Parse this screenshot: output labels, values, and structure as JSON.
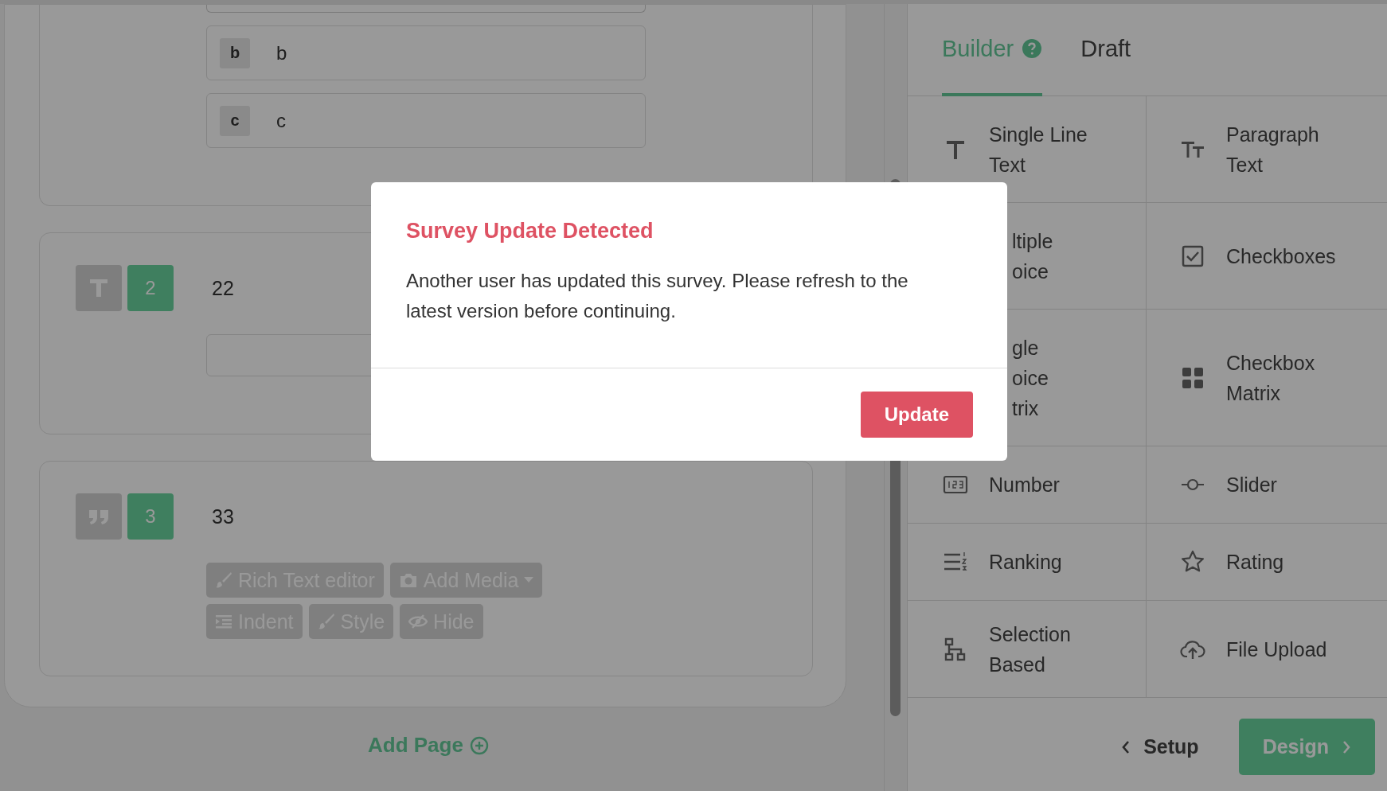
{
  "survey": {
    "options": [
      {
        "key": "b",
        "text": "b"
      },
      {
        "key": "c",
        "text": "c"
      }
    ],
    "questions": [
      {
        "kind": "text",
        "number": "2",
        "title": "22"
      },
      {
        "kind": "quote",
        "number": "3",
        "title": "33",
        "tools": [
          {
            "label": "Rich Text editor",
            "dropdown": false
          },
          {
            "label": "Add Media",
            "dropdown": true
          },
          {
            "label": "Indent",
            "dropdown": false
          },
          {
            "label": "Style",
            "dropdown": false
          },
          {
            "label": "Hide",
            "dropdown": false
          }
        ]
      }
    ],
    "add_page": "Add Page"
  },
  "panel": {
    "tabs": [
      {
        "label": "Builder",
        "selected": true,
        "help": true
      },
      {
        "label": "Draft",
        "selected": false,
        "help": false
      }
    ],
    "items": [
      {
        "kind": "full",
        "label": "Single Line Text"
      },
      {
        "kind": "full",
        "label": "Paragraph Text"
      },
      {
        "kind": "partial",
        "label": "ltiple oice"
      },
      {
        "kind": "full",
        "label": "Checkboxes"
      },
      {
        "kind": "partial",
        "label": "gle oice trix"
      },
      {
        "kind": "full",
        "label": "Checkbox Matrix"
      },
      {
        "kind": "full",
        "label": "Number"
      },
      {
        "kind": "full",
        "label": "Slider"
      },
      {
        "kind": "full",
        "label": "Ranking"
      },
      {
        "kind": "full",
        "label": "Rating"
      },
      {
        "kind": "full",
        "label": "Selection Based"
      },
      {
        "kind": "full",
        "label": "File Upload"
      }
    ],
    "back": "Setup",
    "next": "Design"
  },
  "dialog": {
    "title": "Survey Update Detected",
    "message": "Another user has updated this survey. Please refresh to the latest version before continuing.",
    "button": "Update"
  }
}
